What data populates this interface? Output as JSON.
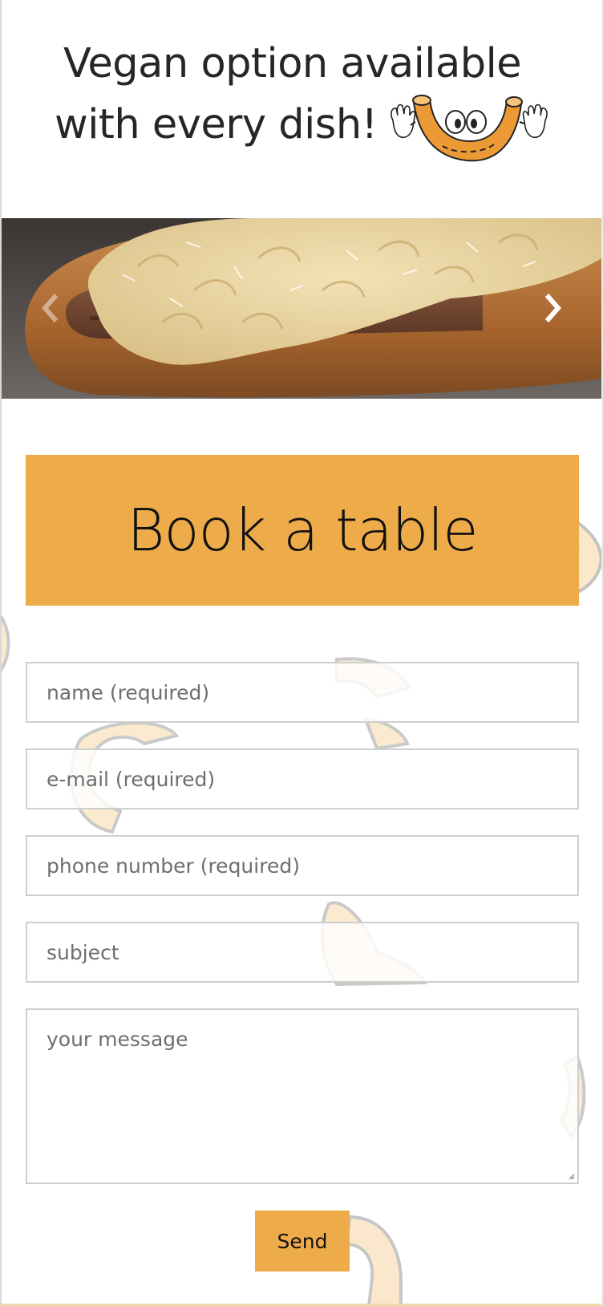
{
  "promo": {
    "line_1": "Vegan option available",
    "line_2": "with every dish!",
    "mascot_icon": "macaroni-mascot-icon"
  },
  "carousel": {
    "image": "hotdog-mac-and-cheese-photo",
    "prev_icon": "chevron-left-icon",
    "next_icon": "chevron-right-icon"
  },
  "booking": {
    "title": "Book a table"
  },
  "form": {
    "name_placeholder": "name (required)",
    "email_placeholder": "e-mail (required)",
    "phone_placeholder": "phone number (required)",
    "subject_placeholder": "subject",
    "message_placeholder": "your message",
    "send_label": "Send"
  },
  "colors": {
    "accent": "#eeab4a",
    "text": "#262626",
    "placeholder": "#6e6e6e",
    "field_border": "#cfcfcf"
  }
}
